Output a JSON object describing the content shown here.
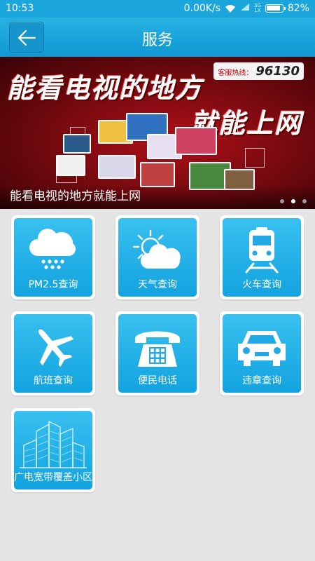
{
  "status_bar": {
    "time": "10:53",
    "speed": "0.00K/s",
    "network_top": "3G",
    "network_bottom": "1X",
    "battery": "82%"
  },
  "header": {
    "title": "服务"
  },
  "banner": {
    "headline_line1": "能看电视的地方",
    "headline_line2": "就能上网",
    "hotline_label": "客服热线：",
    "hotline_number": "96130",
    "caption": "能看电视的地方就能上网",
    "dots_total": 3,
    "active_dot": 2
  },
  "services": [
    {
      "label": "PM2.5查询",
      "icon": "cloud-snow-icon"
    },
    {
      "label": "天气查询",
      "icon": "sun-cloud-icon"
    },
    {
      "label": "火车查询",
      "icon": "train-icon"
    },
    {
      "label": "航班查询",
      "icon": "airplane-icon"
    },
    {
      "label": "便民电话",
      "icon": "telephone-icon"
    },
    {
      "label": "违章查询",
      "icon": "car-icon"
    },
    {
      "label": "广电宽带覆盖小区",
      "icon": "buildings-icon"
    }
  ],
  "colors": {
    "accent": "#1aa6dc",
    "tile": "#22afe8",
    "background": "#e4e4e4"
  }
}
